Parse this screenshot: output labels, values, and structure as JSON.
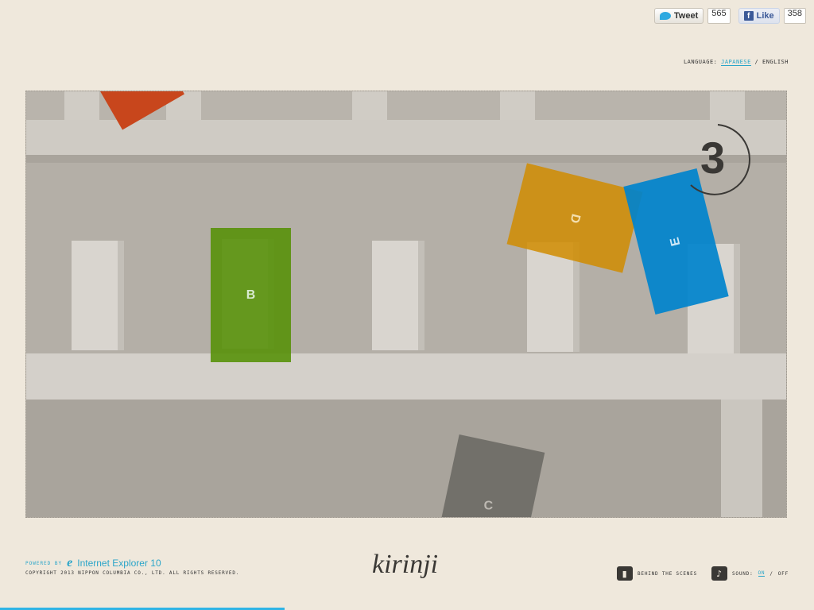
{
  "social": {
    "tweet_label": "Tweet",
    "tweet_count": "565",
    "like_label": "Like",
    "like_count": "358"
  },
  "language": {
    "label": "LANGUAGE:",
    "japanese": "JAPANESE",
    "separator": "/",
    "english": "ENGLISH"
  },
  "stage": {
    "tiles": {
      "b": "B",
      "d": "D",
      "e": "E",
      "c": "C"
    },
    "counter": "3"
  },
  "footer": {
    "powered_by": "POWERED BY",
    "ie_name": "Internet Explorer 10",
    "copyright": "COPYRIGHT 2013 NIPPON COLUMBIA CO., LTD. ALL RIGHTS RESERVED.",
    "logo": "kirinji",
    "behind_scenes": "BEHIND THE SCENES",
    "sound_label": "SOUND:",
    "sound_on": "ON",
    "sound_sep": "/",
    "sound_off": "OFF"
  },
  "progress": {
    "value": 0.35
  },
  "colors": {
    "accent": "#2aa5c9",
    "green": "#58910a",
    "orange": "#d08c00",
    "blue": "#0083cd",
    "red": "#c8461c"
  },
  "icons": {
    "camera": "video-camera-icon",
    "music": "music-note-icon",
    "twitter": "twitter-bird-icon",
    "facebook": "facebook-f-icon",
    "ie": "internet-explorer-icon"
  }
}
